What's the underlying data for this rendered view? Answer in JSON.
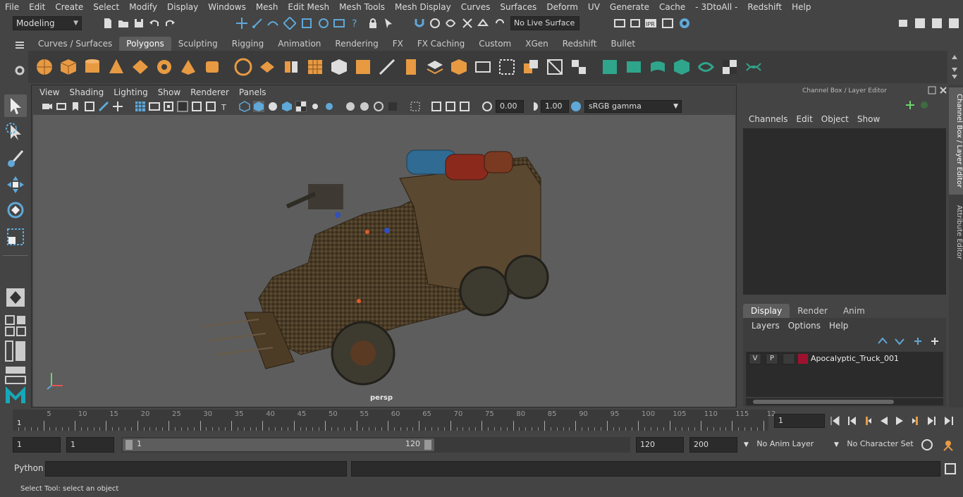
{
  "menubar": {
    "items": [
      "File",
      "Edit",
      "Create",
      "Select",
      "Modify",
      "Display",
      "Windows",
      "Mesh",
      "Edit Mesh",
      "Mesh Tools",
      "Mesh Display",
      "Curves",
      "Surfaces",
      "Deform",
      "UV",
      "Generate",
      "Cache",
      "- 3DtoAll -",
      "Redshift",
      "Help"
    ]
  },
  "statusline": {
    "mode": "Modeling",
    "live_surface": "No Live Surface"
  },
  "shelf": {
    "tabs": [
      "Curves / Surfaces",
      "Polygons",
      "Sculpting",
      "Rigging",
      "Animation",
      "Rendering",
      "FX",
      "FX Caching",
      "Custom",
      "XGen",
      "Redshift",
      "Bullet"
    ],
    "active_tab": "Polygons"
  },
  "viewport": {
    "menu": [
      "View",
      "Shading",
      "Lighting",
      "Show",
      "Renderer",
      "Panels"
    ],
    "exposure": "0.00",
    "gamma": "1.00",
    "color_space": "sRGB gamma",
    "camera_label": "persp"
  },
  "right_panel": {
    "title": "Channel Box / Layer Editor",
    "menu": [
      "Channels",
      "Edit",
      "Object",
      "Show"
    ],
    "layer_tabs": [
      "Display",
      "Render",
      "Anim"
    ],
    "active_layer_tab": "Display",
    "layer_menu": [
      "Layers",
      "Options",
      "Help"
    ],
    "layer": {
      "v": "V",
      "p": "P",
      "name": "Apocalyptic_Truck_001",
      "color": "#9e1230"
    }
  },
  "side_tabs": [
    "Channel Box / Layer Editor",
    "Attribute Editor"
  ],
  "timeslider": {
    "ticks": [
      "5",
      "10",
      "15",
      "20",
      "25",
      "30",
      "35",
      "40",
      "45",
      "50",
      "55",
      "60",
      "65",
      "70",
      "75",
      "80",
      "85",
      "90",
      "95",
      "100",
      "105",
      "110",
      "115",
      "12"
    ],
    "start_label": "1",
    "current_frame": "1"
  },
  "range": {
    "start": "1",
    "anim_start": "1",
    "range_start": "1",
    "range_end": "120",
    "end": "120",
    "anim_end": "200",
    "anim_layer": "No Anim Layer",
    "character_set": "No Character Set"
  },
  "cmdline": {
    "label": "Python"
  },
  "help_line": "Select Tool: select an object",
  "colors": {
    "accent": "#5285a6",
    "layer_red": "#9e1230",
    "shelf_green": "#2fa58b",
    "shelf_orange": "#e79a42"
  }
}
